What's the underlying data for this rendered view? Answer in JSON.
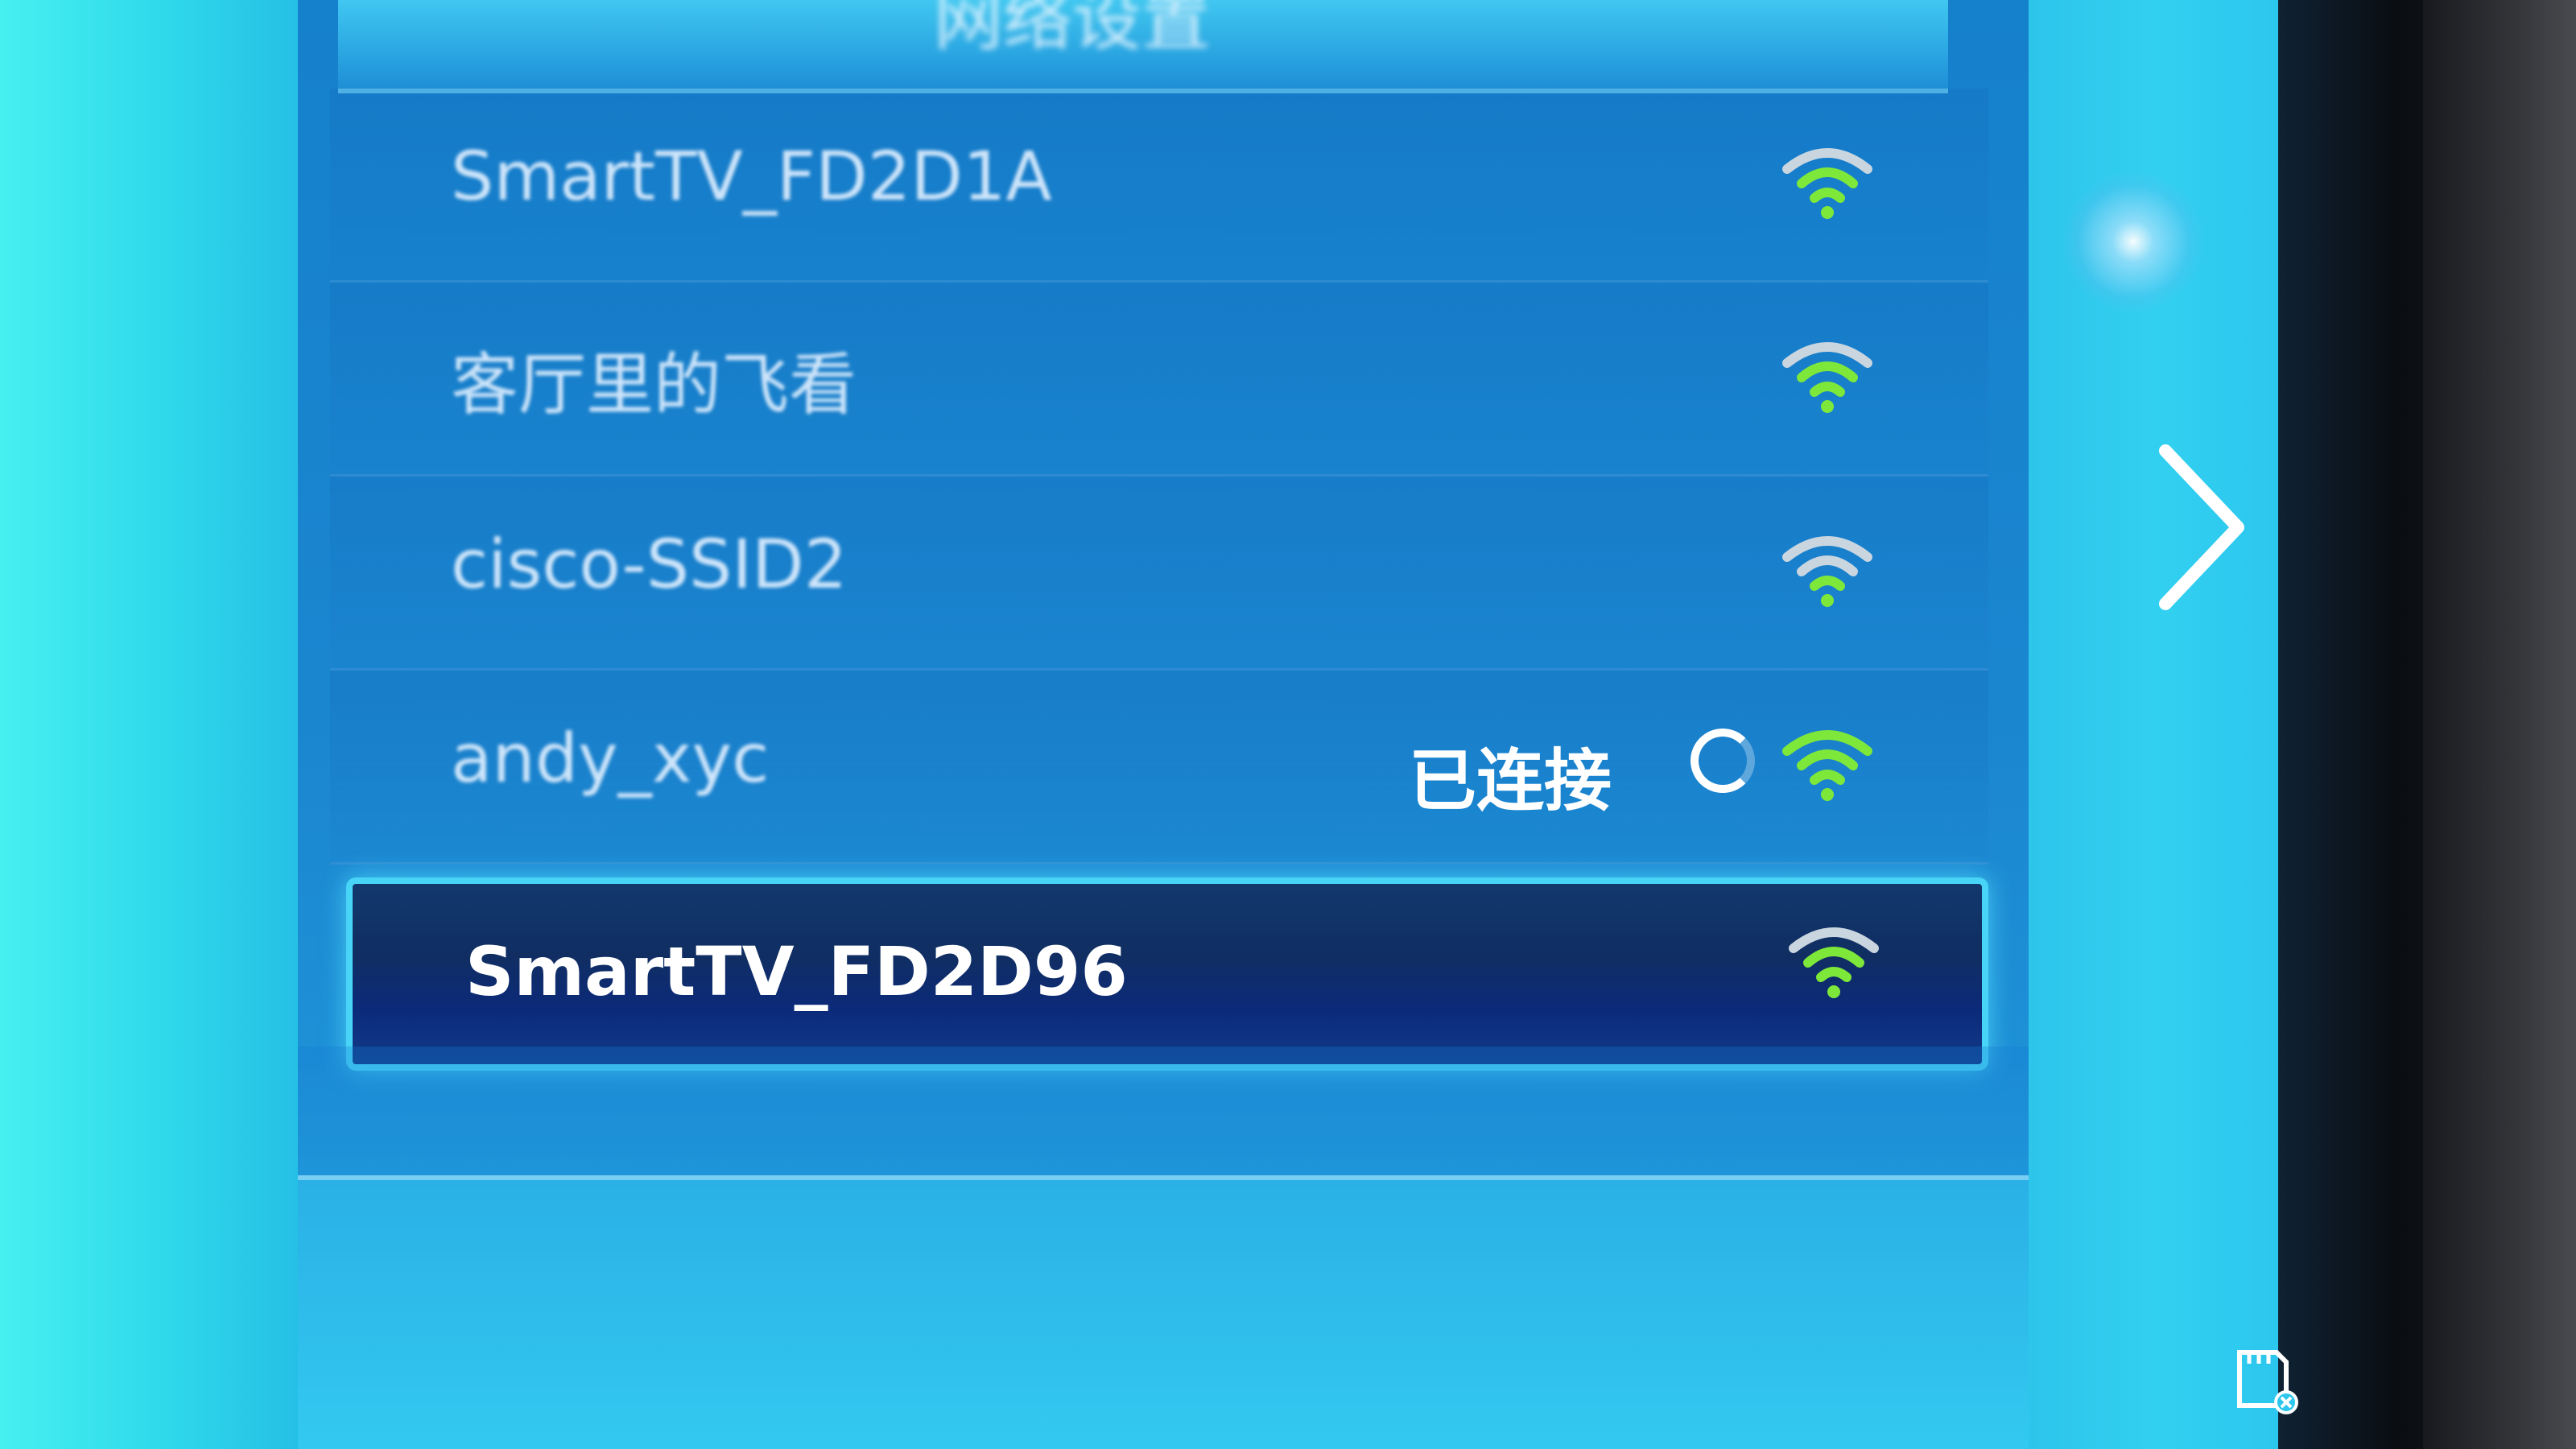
{
  "header": {
    "title": "网络设置"
  },
  "networks": [
    {
      "name": "SmartTV_FD2D1A",
      "status": "",
      "selected": false
    },
    {
      "name": "客厅里的飞看",
      "status": "",
      "selected": false
    },
    {
      "name": "cisco-SSID2",
      "status": "",
      "selected": false
    },
    {
      "name": "andy_xyc",
      "status": "已连接",
      "selected": false
    },
    {
      "name": "SmartTV_FD2D96",
      "status": "",
      "selected": true
    }
  ],
  "icons": {
    "wifi": "wifi-signal-icon",
    "next": "chevron-right-icon",
    "sd": "sd-card-icon",
    "spinner": "loading-spinner-icon"
  },
  "colors": {
    "wifi_green": "#7ee83a",
    "wifi_gray": "#c9d6e0",
    "selected_border": "#47d4f6",
    "panel": "#1b86d0"
  }
}
